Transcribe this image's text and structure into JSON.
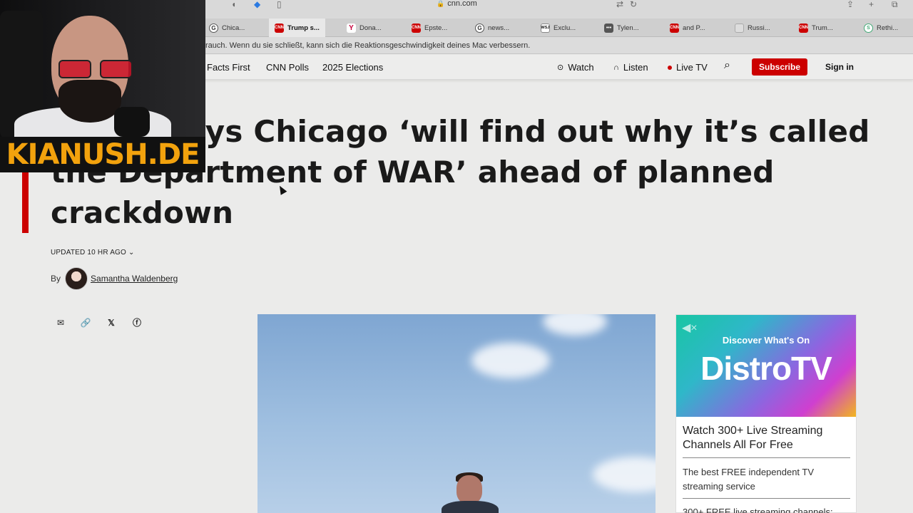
{
  "browser": {
    "url": "cnn.com",
    "tabs": [
      {
        "label": "Chica...",
        "icon": "G",
        "kind": "g"
      },
      {
        "label": "Trump s...",
        "icon": "CNN",
        "kind": "cnn",
        "active": true
      },
      {
        "label": "Dona...",
        "icon": "Y",
        "kind": "y"
      },
      {
        "label": "Epste...",
        "icon": "CNN",
        "kind": "cnn"
      },
      {
        "label": "news...",
        "icon": "G",
        "kind": "g"
      },
      {
        "label": "Exclu...",
        "icon": "WSJ",
        "kind": "wsj"
      },
      {
        "label": "Tylen...",
        "icon": "•••",
        "kind": "dots"
      },
      {
        "label": "and P...",
        "icon": "CNN",
        "kind": "cnn"
      },
      {
        "label": "Russi...",
        "icon": "",
        "kind": "r"
      },
      {
        "label": "Trum...",
        "icon": "CNN",
        "kind": "cnn"
      },
      {
        "label": "Rethi...",
        "icon": "S",
        "kind": "rethink"
      }
    ],
    "notification": "rauch. Wenn du sie schließt, kann sich die Reaktionsgeschwindigkeit deines Mac verbessern."
  },
  "nav": {
    "links": [
      "Facts First",
      "CNN Polls",
      "2025 Elections"
    ],
    "watch": "Watch",
    "listen": "Listen",
    "live_tv": "Live TV",
    "subscribe": "Subscribe",
    "sign_in": "Sign in"
  },
  "article": {
    "headline": "Trump says Chicago ‘will find out why it’s called the Department of WAR’ ahead of planned crackdown",
    "updated": "UPDATED 10 HR AGO",
    "by": "By",
    "author": "Samantha Waldenberg"
  },
  "ad": {
    "discover": "Discover What's On",
    "logo": "DistroTV",
    "title": "Watch 300+ Live Streaming Channels All For Free",
    "description": "The best FREE independent TV streaming service",
    "more": "300+ FREE live streaming channels:"
  },
  "overlay": {
    "brand": "KIANUSH.DE"
  },
  "colors": {
    "cnn_red": "#cc0000",
    "brand_orange": "#f2a20d"
  }
}
